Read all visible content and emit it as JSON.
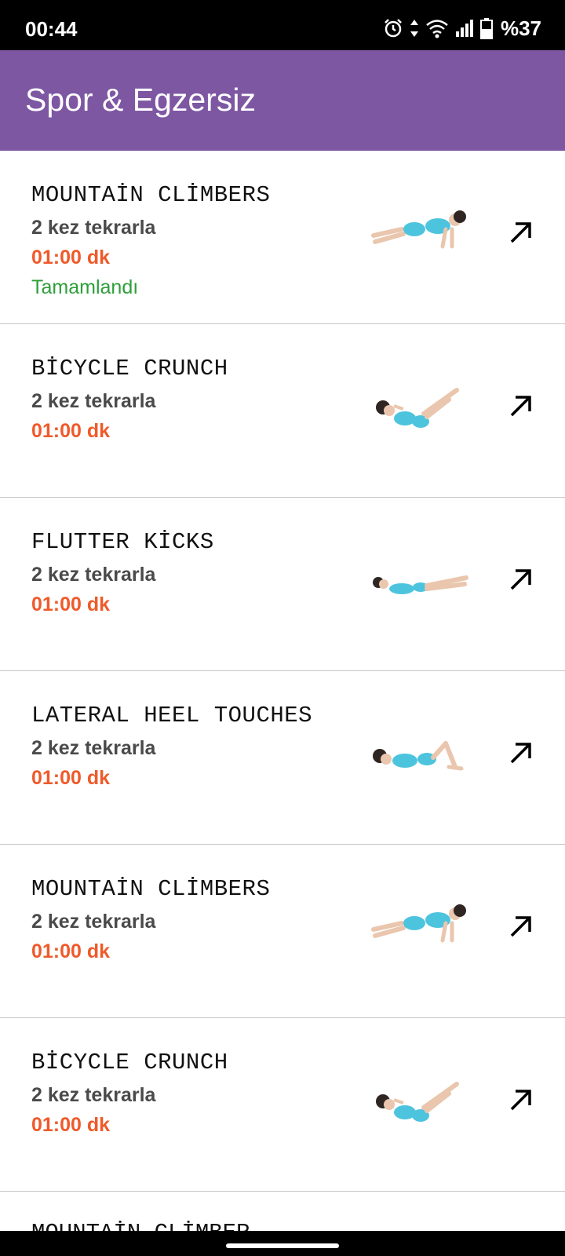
{
  "status_bar": {
    "time": "00:44",
    "battery_text": "%37",
    "icons": [
      "alarm-icon",
      "data-arrows-icon",
      "wifi-icon",
      "signal-icon",
      "battery-icon"
    ]
  },
  "app_bar": {
    "title": "Spor & Egzersiz",
    "color": "#7e57a3"
  },
  "colors": {
    "time": "#ef5a2a",
    "completed": "#2e9e3a",
    "reps": "#4a4a4a"
  },
  "exercises": [
    {
      "title": "MOUNTAİN CLİMBERS",
      "reps": "2 kez tekrarla",
      "duration": "01:00 dk",
      "status": "Tamamlandı",
      "image": "plank-pose"
    },
    {
      "title": "BİCYCLE CRUNCH",
      "reps": "2 kez tekrarla",
      "duration": "01:00 dk",
      "status": "",
      "image": "crunch-pose"
    },
    {
      "title": "FLUTTER KİCKS",
      "reps": "2 kez tekrarla",
      "duration": "01:00 dk",
      "status": "",
      "image": "flutter-pose"
    },
    {
      "title": "LATERAL HEEL TOUCHES",
      "reps": "2 kez tekrarla",
      "duration": "01:00 dk",
      "status": "",
      "image": "heel-touch-pose"
    },
    {
      "title": "MOUNTAİN CLİMBERS",
      "reps": "2 kez tekrarla",
      "duration": "01:00 dk",
      "status": "",
      "image": "plank-pose"
    },
    {
      "title": "BİCYCLE CRUNCH",
      "reps": "2 kez tekrarla",
      "duration": "01:00 dk",
      "status": "",
      "image": "crunch-pose"
    }
  ],
  "partial_item": {
    "title": "MOUNTAİN CLİMBER"
  }
}
